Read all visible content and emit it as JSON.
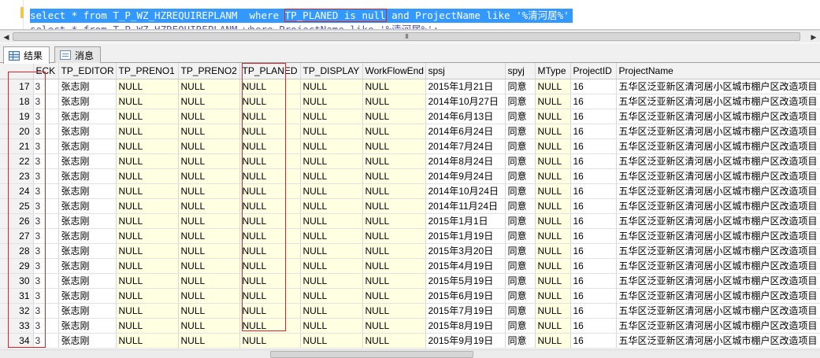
{
  "editor": {
    "line1_pre": "select * from T_P_WZ_HZREQUIREPLANM  where ",
    "line1_highlight": "TP_PLANED is null",
    "line1_post": " and ProjectName like '%清河居%'",
    "line2": "select * from T_P_WZ_HZREQUIREPLANM where ProjectName like '%清河居%';",
    "scroll_grip": "III"
  },
  "tabs": [
    {
      "label": "结果",
      "icon": "grid-icon"
    },
    {
      "label": "消息",
      "icon": "message-icon"
    }
  ],
  "grid": {
    "columns": [
      "",
      "ECK",
      "TP_EDITOR",
      "TP_PRENO1",
      "TP_PRENO2",
      "TP_PLANED",
      "TP_DISPLAY",
      "WorkFlowEnd",
      "spsj",
      "spyj",
      "MType",
      "ProjectID",
      "ProjectName"
    ],
    "eck_value": "3",
    "rows": [
      {
        "n": "17",
        "editor": "张志刚",
        "p1": "NULL",
        "p2": "NULL",
        "planed": "NULL",
        "disp": "NULL",
        "wf": "NULL",
        "spsj": "2015年1月21日",
        "spyj": "同意",
        "mtype": "NULL",
        "pid": "16",
        "pname": "五华区泛亚新区清河居小区城市棚户区改造项目"
      },
      {
        "n": "18",
        "editor": "张志刚",
        "p1": "NULL",
        "p2": "NULL",
        "planed": "NULL",
        "disp": "NULL",
        "wf": "NULL",
        "spsj": "2014年10月27日",
        "spyj": "同意",
        "mtype": "NULL",
        "pid": "16",
        "pname": "五华区泛亚新区清河居小区城市棚户区改造项目"
      },
      {
        "n": "19",
        "editor": "张志刚",
        "p1": "NULL",
        "p2": "NULL",
        "planed": "NULL",
        "disp": "NULL",
        "wf": "NULL",
        "spsj": "2014年6月13日",
        "spyj": "同意",
        "mtype": "NULL",
        "pid": "16",
        "pname": "五华区泛亚新区清河居小区城市棚户区改造项目"
      },
      {
        "n": "20",
        "editor": "张志刚",
        "p1": "NULL",
        "p2": "NULL",
        "planed": "NULL",
        "disp": "NULL",
        "wf": "NULL",
        "spsj": "2014年6月24日",
        "spyj": "同意",
        "mtype": "NULL",
        "pid": "16",
        "pname": "五华区泛亚新区清河居小区城市棚户区改造项目"
      },
      {
        "n": "21",
        "editor": "张志刚",
        "p1": "NULL",
        "p2": "NULL",
        "planed": "NULL",
        "disp": "NULL",
        "wf": "NULL",
        "spsj": "2014年7月24日",
        "spyj": "同意",
        "mtype": "NULL",
        "pid": "16",
        "pname": "五华区泛亚新区清河居小区城市棚户区改造项目"
      },
      {
        "n": "22",
        "editor": "张志刚",
        "p1": "NULL",
        "p2": "NULL",
        "planed": "NULL",
        "disp": "NULL",
        "wf": "NULL",
        "spsj": "2014年8月24日",
        "spyj": "同意",
        "mtype": "NULL",
        "pid": "16",
        "pname": "五华区泛亚新区清河居小区城市棚户区改造项目"
      },
      {
        "n": "23",
        "editor": "张志刚",
        "p1": "NULL",
        "p2": "NULL",
        "planed": "NULL",
        "disp": "NULL",
        "wf": "NULL",
        "spsj": "2014年9月24日",
        "spyj": "同意",
        "mtype": "NULL",
        "pid": "16",
        "pname": "五华区泛亚新区清河居小区城市棚户区改造项目"
      },
      {
        "n": "24",
        "editor": "张志刚",
        "p1": "NULL",
        "p2": "NULL",
        "planed": "NULL",
        "disp": "NULL",
        "wf": "NULL",
        "spsj": "2014年10月24日",
        "spyj": "同意",
        "mtype": "NULL",
        "pid": "16",
        "pname": "五华区泛亚新区清河居小区城市棚户区改造项目"
      },
      {
        "n": "25",
        "editor": "张志刚",
        "p1": "NULL",
        "p2": "NULL",
        "planed": "NULL",
        "disp": "NULL",
        "wf": "NULL",
        "spsj": "2014年11月24日",
        "spyj": "同意",
        "mtype": "NULL",
        "pid": "16",
        "pname": "五华区泛亚新区清河居小区城市棚户区改造项目"
      },
      {
        "n": "26",
        "editor": "张志刚",
        "p1": "NULL",
        "p2": "NULL",
        "planed": "NULL",
        "disp": "NULL",
        "wf": "NULL",
        "spsj": "2015年1月1日",
        "spyj": "同意",
        "mtype": "NULL",
        "pid": "16",
        "pname": "五华区泛亚新区清河居小区城市棚户区改造项目"
      },
      {
        "n": "27",
        "editor": "张志刚",
        "p1": "NULL",
        "p2": "NULL",
        "planed": "NULL",
        "disp": "NULL",
        "wf": "NULL",
        "spsj": "2015年1月19日",
        "spyj": "同意",
        "mtype": "NULL",
        "pid": "16",
        "pname": "五华区泛亚新区清河居小区城市棚户区改造项目"
      },
      {
        "n": "28",
        "editor": "张志刚",
        "p1": "NULL",
        "p2": "NULL",
        "planed": "NULL",
        "disp": "NULL",
        "wf": "NULL",
        "spsj": "2015年3月20日",
        "spyj": "同意",
        "mtype": "NULL",
        "pid": "16",
        "pname": "五华区泛亚新区清河居小区城市棚户区改造项目"
      },
      {
        "n": "29",
        "editor": "张志刚",
        "p1": "NULL",
        "p2": "NULL",
        "planed": "NULL",
        "disp": "NULL",
        "wf": "NULL",
        "spsj": "2015年4月19日",
        "spyj": "同意",
        "mtype": "NULL",
        "pid": "16",
        "pname": "五华区泛亚新区清河居小区城市棚户区改造项目"
      },
      {
        "n": "30",
        "editor": "张志刚",
        "p1": "NULL",
        "p2": "NULL",
        "planed": "NULL",
        "disp": "NULL",
        "wf": "NULL",
        "spsj": "2015年5月19日",
        "spyj": "同意",
        "mtype": "NULL",
        "pid": "16",
        "pname": "五华区泛亚新区清河居小区城市棚户区改造项目"
      },
      {
        "n": "31",
        "editor": "张志刚",
        "p1": "NULL",
        "p2": "NULL",
        "planed": "NULL",
        "disp": "NULL",
        "wf": "NULL",
        "spsj": "2015年6月19日",
        "spyj": "同意",
        "mtype": "NULL",
        "pid": "16",
        "pname": "五华区泛亚新区清河居小区城市棚户区改造项目"
      },
      {
        "n": "32",
        "editor": "张志刚",
        "p1": "NULL",
        "p2": "NULL",
        "planed": "NULL",
        "disp": "NULL",
        "wf": "NULL",
        "spsj": "2015年7月19日",
        "spyj": "同意",
        "mtype": "NULL",
        "pid": "16",
        "pname": "五华区泛亚新区清河居小区城市棚户区改造项目"
      },
      {
        "n": "33",
        "editor": "张志刚",
        "p1": "NULL",
        "p2": "NULL",
        "planed": "NULL",
        "disp": "NULL",
        "wf": "NULL",
        "spsj": "2015年8月19日",
        "spyj": "同意",
        "mtype": "NULL",
        "pid": "16",
        "pname": "五华区泛亚新区清河居小区城市棚户区改造项目"
      },
      {
        "n": "34",
        "editor": "张志刚",
        "p1": "NULL",
        "p2": "NULL",
        "planed": "NULL",
        "disp": "NULL",
        "wf": "NULL",
        "spsj": "2015年9月19日",
        "spyj": "同意",
        "mtype": "NULL",
        "pid": "16",
        "pname": "五华区泛亚新区清河居小区城市棚户区改造项目"
      }
    ]
  },
  "colors": {
    "selection": "#3399ff",
    "annotation": "#d9262b",
    "null_cell": "#ffffe1",
    "header_bg": "#f2f2f2"
  }
}
